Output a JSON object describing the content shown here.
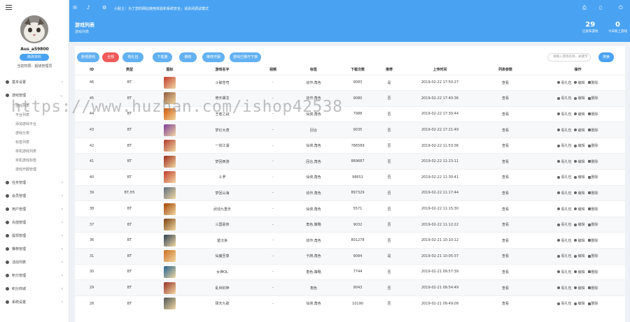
{
  "sidebar": {
    "username": "Aus_a59800",
    "profile_button": "修改资料",
    "role": "当前权限：超级管理员",
    "menu": [
      {
        "label": "基本设置",
        "top": 0
      },
      {
        "label": "游戏管理",
        "top": 0
      }
    ],
    "sub_items": [
      "游戏列表",
      "平台列表",
      "添加游戏平台",
      "游戏分类",
      "标签列表",
      "单机游戏列表",
      "单机游戏标签",
      "游戏开服管理"
    ],
    "groups": [
      "任务管理",
      "会员管理",
      "用户管理",
      "充值管理",
      "提现管理",
      "推荐管理",
      "活动列表",
      "积分管理",
      "积分商城",
      "系统设置"
    ]
  },
  "header": {
    "notice": "小贴士：为了您的网站使用体验和系统安全，请关闭调试模式"
  },
  "banner": {
    "title": "游戏列表",
    "subtitle": "游戏列表",
    "stats": [
      {
        "num": "29",
        "label": "已发布游戏"
      },
      {
        "num": "0",
        "label": "今日新上游戏"
      }
    ]
  },
  "toolbar": {
    "buttons": [
      "新增游戏",
      "全部",
      "热礼包",
      "下载量",
      "推荐",
      "推荐开服",
      "游戏已推开下架"
    ],
    "search_placeholder": "请输入游戏名称、关键字",
    "search_button": "搜索"
  },
  "table": {
    "headers": [
      "ID",
      "类型",
      "图标",
      "游戏名字",
      "视频",
      "标签",
      "下载次数",
      "推荐",
      "上传时间",
      "列表参数",
      "操作"
    ],
    "rows": [
      {
        "id": "46",
        "type": "BT",
        "name": "斗破苍穹",
        "video": "-",
        "tag": "动作,角色",
        "downloads": "9083",
        "rec": "是",
        "time": "2019-02-22 17:50:27",
        "param": "查看"
      },
      {
        "id": "45",
        "type": "BT",
        "name": "倚天屠龙",
        "video": "-",
        "tag": "动作,角色",
        "downloads": "9080",
        "rec": "否",
        "time": "2019-02-22 17:40:36",
        "param": "查看"
      },
      {
        "id": "44",
        "type": "BT",
        "name": "王者之战",
        "video": "-",
        "tag": "仙侠,角色",
        "downloads": "7988",
        "rec": "否",
        "time": "2019-02-22 17:30:44",
        "param": "查看"
      },
      {
        "id": "43",
        "type": "BT",
        "name": "梦幻大唐",
        "video": "-",
        "tag": "回合",
        "downloads": "9035",
        "rec": "否",
        "time": "2019-02-22 17:21:49",
        "param": "查看"
      },
      {
        "id": "42",
        "type": "BT",
        "name": "一剑江湖",
        "video": "-",
        "tag": "仙侠,角色",
        "downloads": "786589",
        "rec": "否",
        "time": "2019-02-22 11:53:36",
        "param": "查看"
      },
      {
        "id": "41",
        "type": "BT",
        "name": "梦回西游",
        "video": "-",
        "tag": "回合,角色",
        "downloads": "889687",
        "rec": "否",
        "time": "2019-02-22 11:23:11",
        "param": "查看"
      },
      {
        "id": "40",
        "type": "BT",
        "name": "斗罗",
        "video": "-",
        "tag": "仙侠,角色",
        "downloads": "98651",
        "rec": "否",
        "time": "2019-02-22 11:30:41",
        "param": "查看"
      },
      {
        "id": "39",
        "type": "BT,H5",
        "name": "梦回山海",
        "video": "-",
        "tag": "动作,角色",
        "downloads": "897329",
        "rec": "否",
        "time": "2019-02-22 11:17:44",
        "param": "查看"
      },
      {
        "id": "38",
        "type": "BT",
        "name": "武动九重天",
        "video": "-",
        "tag": "仙侠,角色",
        "downloads": "5571",
        "rec": "否",
        "time": "2019-02-22 11:15:30",
        "param": "查看"
      },
      {
        "id": "37",
        "type": "BT",
        "name": "三国豪侠",
        "video": "-",
        "tag": "角色,策略",
        "downloads": "9032",
        "rec": "否",
        "time": "2019-02-22 11:12:22",
        "param": "查看"
      },
      {
        "id": "36",
        "type": "BT",
        "name": "楚汉争",
        "video": "-",
        "tag": "动作,角色",
        "downloads": "801278",
        "rec": "否",
        "time": "2019-02-21 10:10:12",
        "param": "查看"
      },
      {
        "id": "31",
        "type": "BT",
        "name": "仙魔至尊",
        "video": "-",
        "tag": "卡牌,角色",
        "downloads": "9084",
        "rec": "是",
        "time": "2019-02-21 10:05:37",
        "param": "查看"
      },
      {
        "id": "30",
        "type": "BT",
        "name": "女神OL",
        "video": "-",
        "tag": "角色,策略",
        "downloads": "7744",
        "rec": "否",
        "time": "2019-02-21 09:57:39",
        "param": "查看"
      },
      {
        "id": "29",
        "type": "BT",
        "name": "乱世封神",
        "video": "-",
        "tag": "角色",
        "downloads": "9043",
        "rec": "否",
        "time": "2019-02-21 09:54:49",
        "param": "查看"
      },
      {
        "id": "28",
        "type": "BT",
        "name": "择天九歌",
        "video": "-",
        "tag": "仙侠,角色",
        "downloads": "10190",
        "rec": "否",
        "time": "2019-02-21 09:49:09",
        "param": "查看"
      }
    ],
    "actions": [
      "看礼包",
      "编辑",
      "删除"
    ]
  },
  "icon_colors": [
    "#c0392b",
    "#8e5a3c",
    "#d35400",
    "#7d3c98",
    "#b03a2e",
    "#9c2a1a",
    "#c0392b",
    "#5d6d7e",
    "#a04000",
    "#784212",
    "#2e4053",
    "#ca6f1e",
    "#1f618d",
    "#943126",
    "#4d5656"
  ],
  "watermark": "https://www.huzhan.com/ishop42538"
}
